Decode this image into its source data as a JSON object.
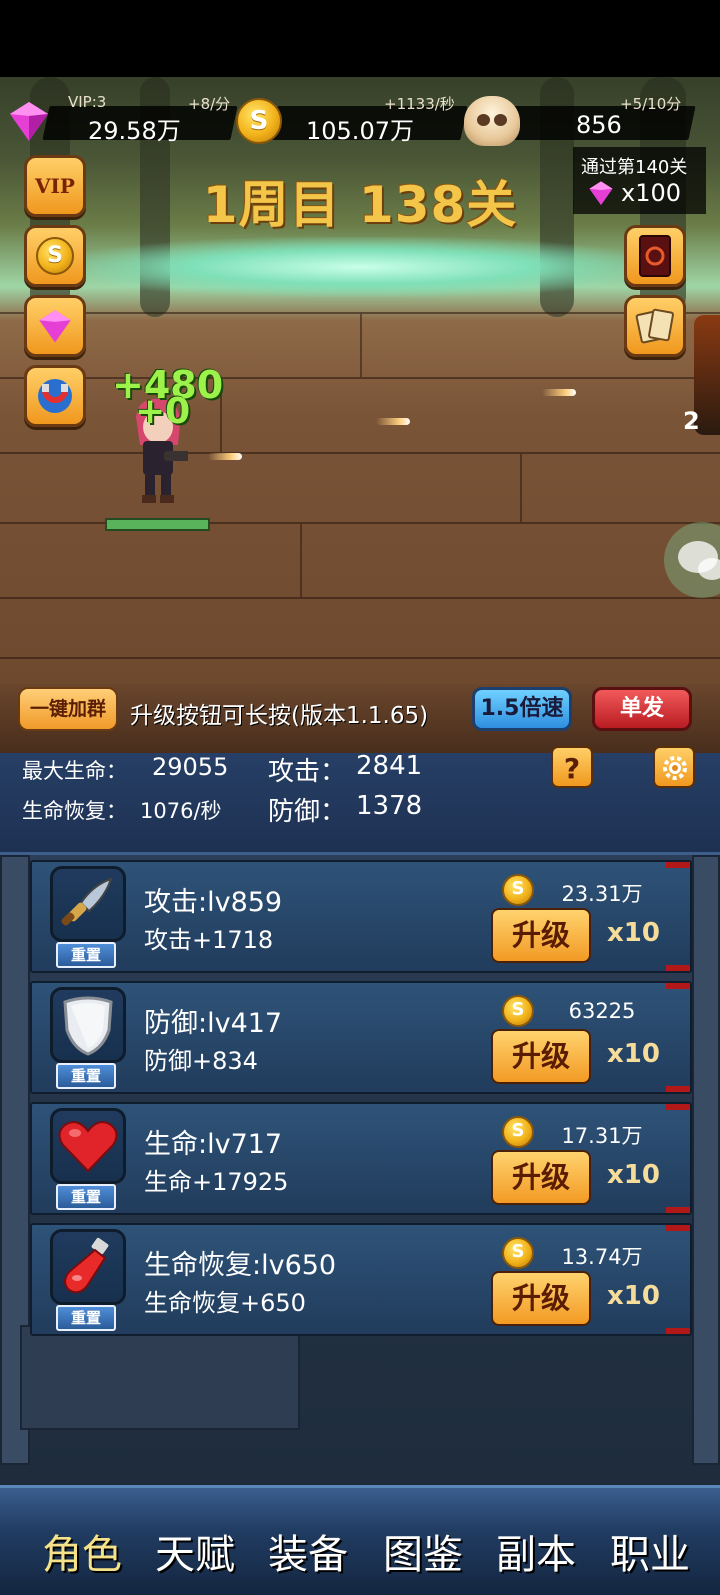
{
  "resources": [
    {
      "name": "gem",
      "label": "VIP:3",
      "value": "29.58万",
      "rate": "+8/分"
    },
    {
      "name": "coin",
      "value": "105.07万",
      "rate": "+1133/秒"
    },
    {
      "name": "skull",
      "value": "856",
      "rate": "+5/10分"
    }
  ],
  "coin_glyph": "S",
  "stage_title": "1周目 138关",
  "reward": {
    "text": "通过第140关",
    "amount": "x100"
  },
  "side_buttons": {
    "vip": "VIP"
  },
  "battle": {
    "damage_1": "+480",
    "damage_2": "+0",
    "partial_text": "2"
  },
  "action_bar": {
    "join_group": "一键加群",
    "tip": "升级按钮可长按(版本1.1.65)",
    "speed": "1.5倍速",
    "mode": "单发"
  },
  "stats": {
    "max_hp_label": "最大生命：",
    "max_hp": "29055",
    "attack_label": "攻击：",
    "attack": "2841",
    "regen_label": "生命恢复：",
    "regen": "1076/秒",
    "defense_label": "防御：",
    "defense": "1378",
    "help": "?"
  },
  "upgrades": [
    {
      "name": "攻击:lv859",
      "desc": "攻击+1718",
      "cost": "23.31万",
      "button": "升级",
      "multiplier": "x10",
      "reset": "重置",
      "icon": "dagger-icon"
    },
    {
      "name": "防御:lv417",
      "desc": "防御+834",
      "cost": "63225",
      "button": "升级",
      "multiplier": "x10",
      "reset": "重置",
      "icon": "shield-icon"
    },
    {
      "name": "生命:lv717",
      "desc": "生命+17925",
      "cost": "17.31万",
      "button": "升级",
      "multiplier": "x10",
      "reset": "重置",
      "icon": "heart-icon"
    },
    {
      "name": "生命恢复:lv650",
      "desc": "生命恢复+650",
      "cost": "13.74万",
      "button": "升级",
      "multiplier": "x10",
      "reset": "重置",
      "icon": "potion-icon"
    }
  ],
  "tabs": [
    "角色",
    "天赋",
    "装备",
    "图鉴",
    "副本",
    "职业"
  ],
  "active_tab": "角色",
  "colors": {
    "accent_gold": "#f3c64a",
    "panel_blue": "#213c5c",
    "hp_green": "#58b35a"
  }
}
